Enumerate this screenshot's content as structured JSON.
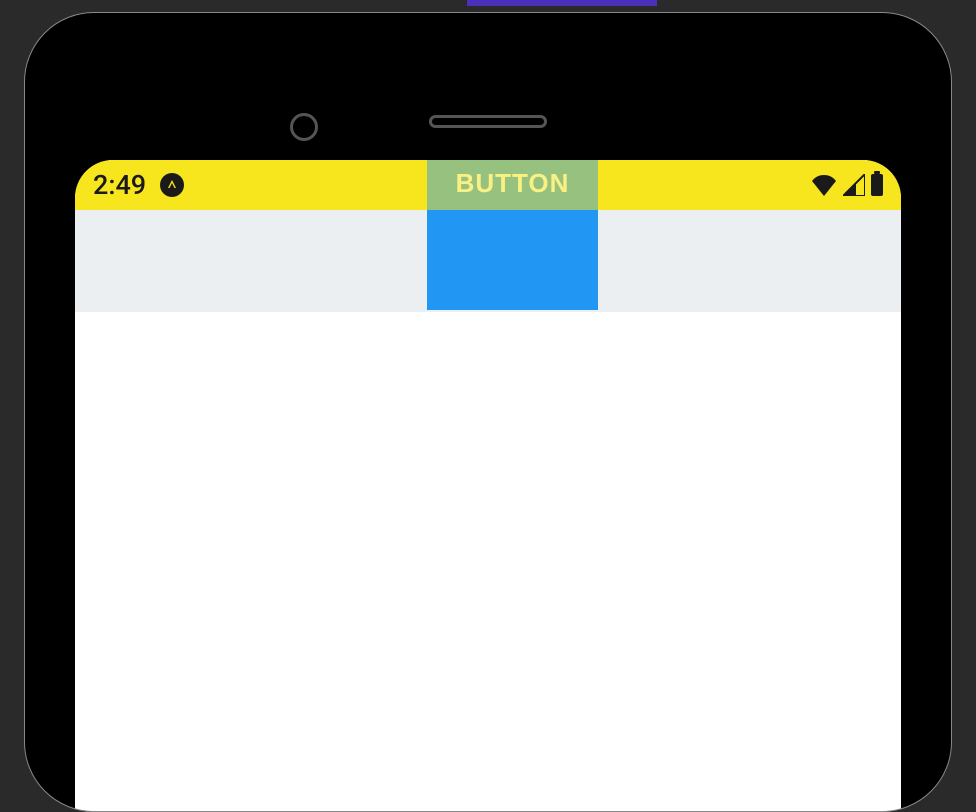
{
  "status_bar": {
    "time": "2:49"
  },
  "button": {
    "label": "BUTTON"
  },
  "colors": {
    "status_bg": "#f7e51e",
    "button_bg": "#2196f3",
    "toolbar_bg": "#eceff1"
  }
}
